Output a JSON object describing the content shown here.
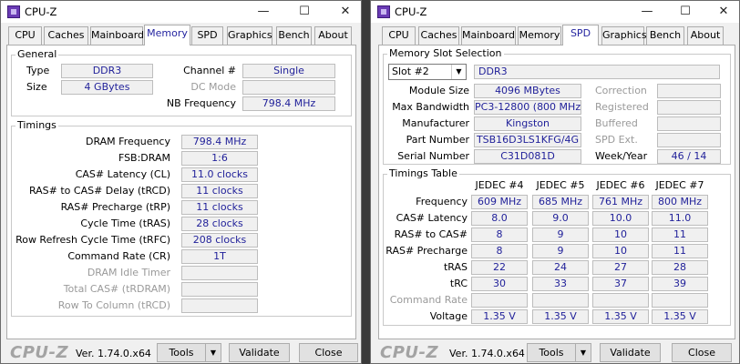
{
  "w1": {
    "title": "CPU-Z",
    "tabs": [
      "CPU",
      "Caches",
      "Mainboard",
      "Memory",
      "SPD",
      "Graphics",
      "Bench",
      "About"
    ],
    "general": {
      "title": "General",
      "type_label": "Type",
      "type_value": "DDR3",
      "size_label": "Size",
      "size_value": "4 GBytes",
      "channel_label": "Channel #",
      "channel_value": "Single",
      "dc_label": "DC Mode",
      "dc_value": "",
      "nb_label": "NB Frequency",
      "nb_value": "798.4 MHz"
    },
    "timings": {
      "title": "Timings",
      "rows": [
        {
          "label": "DRAM Frequency",
          "value": "798.4 MHz"
        },
        {
          "label": "FSB:DRAM",
          "value": "1:6"
        },
        {
          "label": "CAS# Latency (CL)",
          "value": "11.0 clocks"
        },
        {
          "label": "RAS# to CAS# Delay (tRCD)",
          "value": "11 clocks"
        },
        {
          "label": "RAS# Precharge (tRP)",
          "value": "11 clocks"
        },
        {
          "label": "Cycle Time (tRAS)",
          "value": "28 clocks"
        },
        {
          "label": "Row Refresh Cycle Time (tRFC)",
          "value": "208 clocks"
        },
        {
          "label": "Command Rate (CR)",
          "value": "1T"
        },
        {
          "label": "DRAM Idle Timer",
          "value": ""
        },
        {
          "label": "Total CAS# (tRDRAM)",
          "value": ""
        },
        {
          "label": "Row To Column (tRCD)",
          "value": ""
        }
      ]
    }
  },
  "w2": {
    "title": "CPU-Z",
    "tabs": [
      "CPU",
      "Caches",
      "Mainboard",
      "Memory",
      "SPD",
      "Graphics",
      "Bench",
      "About"
    ],
    "slot": {
      "title": "Memory Slot Selection",
      "selected": "Slot #2",
      "type_value": "DDR3",
      "left": [
        {
          "label": "Module Size",
          "value": "4096 MBytes"
        },
        {
          "label": "Max Bandwidth",
          "value": "PC3-12800 (800 MHz)"
        },
        {
          "label": "Manufacturer",
          "value": "Kingston"
        },
        {
          "label": "Part Number",
          "value": "TSB16D3LS1KFG/4G"
        },
        {
          "label": "Serial Number",
          "value": "C31D081D"
        }
      ],
      "right": [
        {
          "label": "Correction",
          "value": ""
        },
        {
          "label": "Registered",
          "value": ""
        },
        {
          "label": "Buffered",
          "value": ""
        },
        {
          "label": "SPD Ext.",
          "value": ""
        },
        {
          "label": "Week/Year",
          "value": "46 / 14"
        }
      ]
    },
    "table": {
      "title": "Timings Table",
      "headers": [
        "JEDEC #4",
        "JEDEC #5",
        "JEDEC #6",
        "JEDEC #7"
      ],
      "rows": [
        {
          "label": "Frequency",
          "values": [
            "609 MHz",
            "685 MHz",
            "761 MHz",
            "800 MHz"
          ]
        },
        {
          "label": "CAS# Latency",
          "values": [
            "8.0",
            "9.0",
            "10.0",
            "11.0"
          ]
        },
        {
          "label": "RAS# to CAS#",
          "values": [
            "8",
            "9",
            "10",
            "11"
          ]
        },
        {
          "label": "RAS# Precharge",
          "values": [
            "8",
            "9",
            "10",
            "11"
          ]
        },
        {
          "label": "tRAS",
          "values": [
            "22",
            "24",
            "27",
            "28"
          ]
        },
        {
          "label": "tRC",
          "values": [
            "30",
            "33",
            "37",
            "39"
          ]
        },
        {
          "label": "Command Rate",
          "values": [
            "",
            "",
            "",
            ""
          ]
        },
        {
          "label": "Voltage",
          "values": [
            "1.35 V",
            "1.35 V",
            "1.35 V",
            "1.35 V"
          ]
        }
      ]
    }
  },
  "footer": {
    "logo": "CPU-Z",
    "version": "Ver. 1.74.0.x64",
    "tools": "Tools",
    "validate": "Validate",
    "close": "Close"
  }
}
